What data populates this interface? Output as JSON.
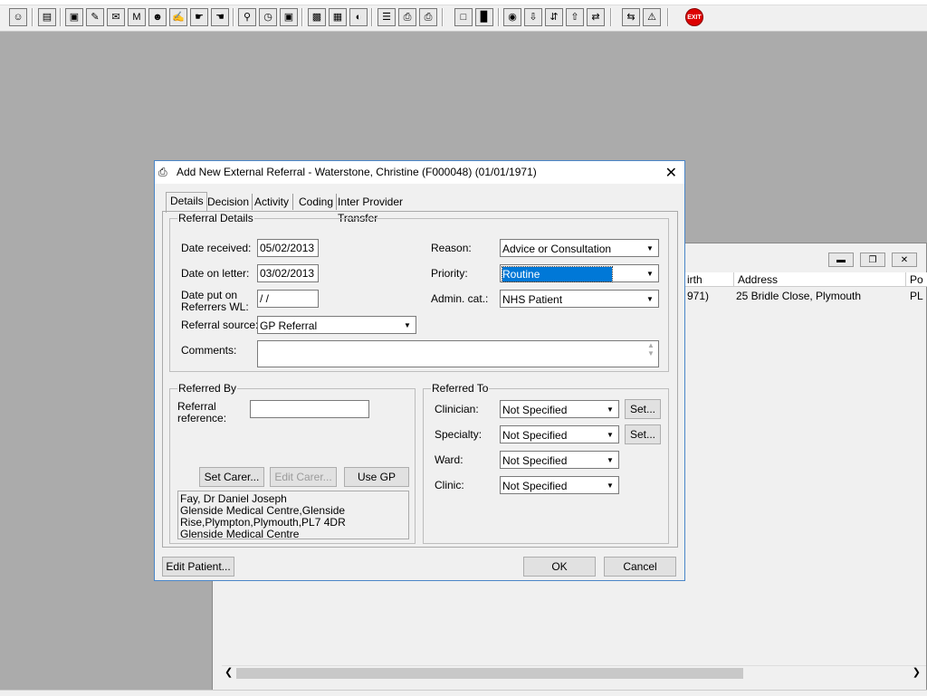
{
  "toolbar": {
    "icons": [
      "patient-search-icon",
      "patient-list-icon",
      "book-icon",
      "clipboard-edit-icon",
      "letters-icon",
      "mail-merge-icon",
      "user-icon",
      "notes-icon",
      "hands-icon",
      "hands-alt-icon",
      "monitor-search-icon",
      "clock-icon",
      "screen-icon",
      "presentation-icon",
      "chart-board-icon",
      "gauge-icon",
      "document-list-icon",
      "printer-icon",
      "printer-alt-icon",
      "page-icon",
      "bar-chart-icon",
      "globe-icon",
      "download-icon",
      "transfer-icon",
      "upload-icon",
      "swap-icon",
      "warning-icon",
      "exit-icon"
    ],
    "exit_label": "EXIT"
  },
  "background_window": {
    "columns": [
      "irth",
      "Address",
      "Po"
    ],
    "row": [
      "971)",
      "25 Bridle Close, Plymouth",
      "PL"
    ]
  },
  "dialog": {
    "title": "Add New External Referral - Waterstone, Christine (F000048) (01/01/1971)",
    "tabs": [
      "Details",
      "Decision",
      "Activity",
      "Coding",
      "Inter Provider Transfer"
    ],
    "referral_details": {
      "legend": "Referral Details",
      "date_received_label": "Date received:",
      "date_received": "05/02/2013",
      "date_on_letter_label": "Date on letter:",
      "date_on_letter": "03/02/2013",
      "date_put_label_1": "Date put on",
      "date_put_label_2": "Referrers WL:",
      "date_put": " /  /",
      "referral_source_label": "Referral source:",
      "referral_source": "GP Referral",
      "reason_label": "Reason:",
      "reason": "Advice or Consultation",
      "priority_label": "Priority:",
      "priority": "Routine",
      "admin_cat_label": "Admin. cat.:",
      "admin_cat": "NHS Patient",
      "comments_label": "Comments:",
      "comments": ""
    },
    "referred_by": {
      "legend": "Referred By",
      "reference_label_1": "Referral",
      "reference_label_2": "reference:",
      "reference": "",
      "set_carer": "Set Carer...",
      "edit_carer": "Edit Carer...",
      "use_gp": "Use GP",
      "gp_lines": [
        "Fay, Dr Daniel Joseph",
        "Glenside Medical Centre,Glenside",
        "Rise,Plympton,Plymouth,PL7 4DR",
        "Glenside Medical Centre"
      ]
    },
    "referred_to": {
      "legend": "Referred To",
      "clinician_label": "Clinician:",
      "clinician": "Not Specified",
      "specialty_label": "Specialty:",
      "specialty": "Not Specified",
      "ward_label": "Ward:",
      "ward": "Not Specified",
      "clinic_label": "Clinic:",
      "clinic": "Not Specified",
      "set_label": "Set..."
    },
    "buttons": {
      "edit_patient": "Edit Patient...",
      "ok": "OK",
      "cancel": "Cancel"
    }
  },
  "colors": {
    "selection": "#0078d7",
    "desktop": "#ababab",
    "dialog_border": "#4a86c8"
  }
}
